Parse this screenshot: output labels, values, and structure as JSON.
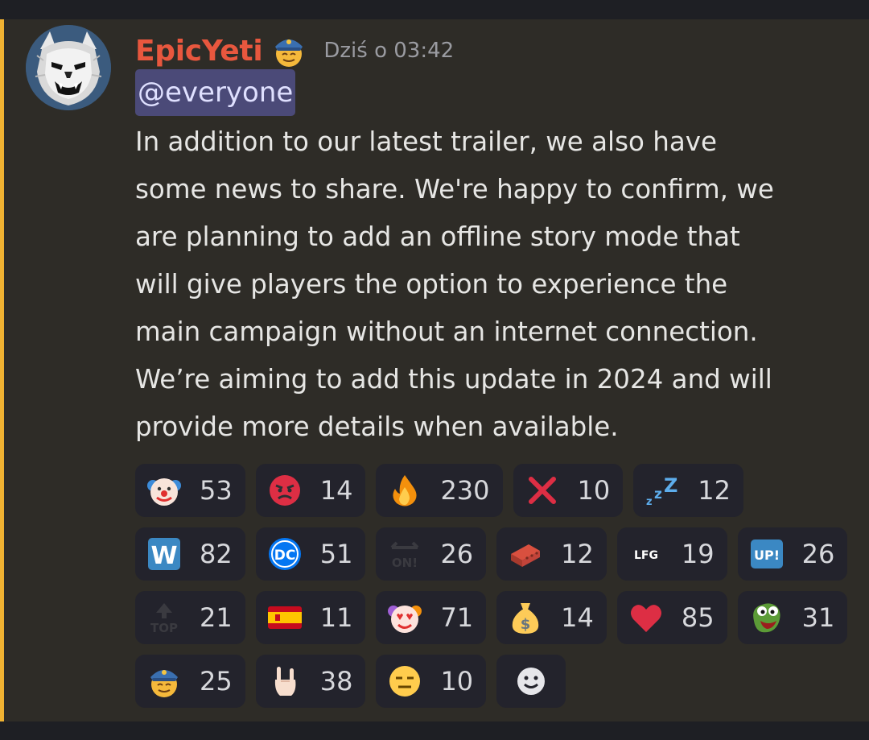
{
  "message": {
    "author": "EpicYeti",
    "timestamp": "Dziś o 03:42",
    "mention": "@everyone",
    "body_lines": [
      "In addition to our latest trailer, we also have",
      "some news to share. We're happy to confirm, we",
      "are planning to add an offline story mode that",
      "will give players the option to experience the",
      "main campaign without an internet connection.",
      "We’re aiming to add this update in 2024 and will",
      "provide more details when available."
    ]
  },
  "reactions": [
    {
      "icon": "clown-face-icon",
      "count": "53"
    },
    {
      "icon": "angry-face-icon",
      "count": "14"
    },
    {
      "icon": "fire-icon",
      "count": "230"
    },
    {
      "icon": "cross-mark-icon",
      "count": "10"
    },
    {
      "icon": "zzz-icon",
      "count": "12"
    },
    {
      "icon": "w-letter-icon",
      "count": "82"
    },
    {
      "icon": "dc-logo-icon",
      "count": "51"
    },
    {
      "icon": "on-arrow-icon",
      "count": "26"
    },
    {
      "icon": "brick-icon",
      "count": "12"
    },
    {
      "icon": "lfg-icon",
      "count": "19"
    },
    {
      "icon": "up-button-icon",
      "count": "26"
    },
    {
      "icon": "top-arrow-icon",
      "count": "21"
    },
    {
      "icon": "spain-flag-icon",
      "count": "11"
    },
    {
      "icon": "clown-heart-eyes-icon",
      "count": "71"
    },
    {
      "icon": "money-bag-icon",
      "count": "14"
    },
    {
      "icon": "red-heart-icon",
      "count": "85"
    },
    {
      "icon": "pepe-frog-icon",
      "count": "31"
    },
    {
      "icon": "pilot-face-icon",
      "count": "25"
    },
    {
      "icon": "rock-hand-icon",
      "count": "38"
    },
    {
      "icon": "expressionless-face-icon",
      "count": "10"
    }
  ],
  "glyph_text": {
    "lfg": "LFG",
    "up": "UP!",
    "on": "ON!",
    "top": "TOP",
    "dc": "DC",
    "w": "W"
  },
  "colors": {
    "username": "#e8573e",
    "accent_bar": "#f0b232",
    "mention_bg": "#4b4a78",
    "reaction_bg": "#23232c"
  }
}
